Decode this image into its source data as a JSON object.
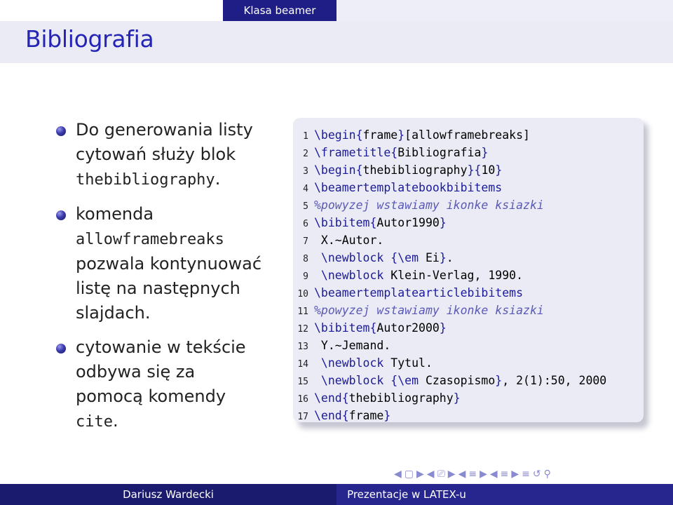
{
  "header": {
    "section": "Klasa beamer",
    "colors": {
      "section_bg": "#1e1e86",
      "title_text": "#2525b5"
    }
  },
  "frame": {
    "title": "Bibliografia"
  },
  "bullets": [
    {
      "pre": "Do generowania listy cytowań służy blok ",
      "code": "thebibliography",
      "post": "."
    },
    {
      "pre": "komenda ",
      "code": "allowframebreaks",
      "post": " pozwala kontynuować listę na następnych slajdach."
    },
    {
      "pre": "cytowanie w tekście odbywa się za pomocą komendy ",
      "code": "cite",
      "post": "."
    }
  ],
  "code": {
    "lines": [
      {
        "n": "1",
        "parts": [
          {
            "t": "\\begin{",
            "c": "kw"
          },
          {
            "t": "frame",
            "c": ""
          },
          {
            "t": "}",
            "c": "kw"
          },
          {
            "t": "[allowframebreaks]",
            "c": ""
          }
        ]
      },
      {
        "n": "2",
        "parts": [
          {
            "t": "\\frametitle{",
            "c": "kw"
          },
          {
            "t": "Bibliografia",
            "c": ""
          },
          {
            "t": "}",
            "c": "kw"
          }
        ]
      },
      {
        "n": "3",
        "parts": [
          {
            "t": "\\begin{",
            "c": "kw"
          },
          {
            "t": "thebibliography",
            "c": ""
          },
          {
            "t": "}{",
            "c": "kw"
          },
          {
            "t": "10",
            "c": ""
          },
          {
            "t": "}",
            "c": "kw"
          }
        ]
      },
      {
        "n": "4",
        "parts": [
          {
            "t": "\\beamertemplatebookbibitems",
            "c": "kw"
          }
        ]
      },
      {
        "n": "5",
        "parts": [
          {
            "t": "%powyzej wstawiamy ikonke ksiazki",
            "c": "cm"
          }
        ]
      },
      {
        "n": "6",
        "parts": [
          {
            "t": "\\bibitem{",
            "c": "kw"
          },
          {
            "t": "Autor1990",
            "c": ""
          },
          {
            "t": "}",
            "c": "kw"
          }
        ]
      },
      {
        "n": "7",
        "parts": [
          {
            "t": " X.~Autor.",
            "c": ""
          }
        ]
      },
      {
        "n": "8",
        "parts": [
          {
            "t": " \\newblock {\\em ",
            "c": "kw"
          },
          {
            "t": "Ei",
            "c": ""
          },
          {
            "t": "}",
            "c": "kw"
          },
          {
            "t": ".",
            "c": ""
          }
        ]
      },
      {
        "n": "9",
        "parts": [
          {
            "t": " \\newblock ",
            "c": "kw"
          },
          {
            "t": "Klein-Verlag, 1990.",
            "c": ""
          }
        ]
      },
      {
        "n": "10",
        "parts": [
          {
            "t": "\\beamertemplatearticlebibitems",
            "c": "kw"
          }
        ]
      },
      {
        "n": "11",
        "parts": [
          {
            "t": "%powyzej wstawiamy ikonke ksiazki",
            "c": "cm"
          }
        ]
      },
      {
        "n": "12",
        "parts": [
          {
            "t": "\\bibitem{",
            "c": "kw"
          },
          {
            "t": "Autor2000",
            "c": ""
          },
          {
            "t": "}",
            "c": "kw"
          }
        ]
      },
      {
        "n": "13",
        "parts": [
          {
            "t": " Y.~Jemand.",
            "c": ""
          }
        ]
      },
      {
        "n": "14",
        "parts": [
          {
            "t": " \\newblock ",
            "c": "kw"
          },
          {
            "t": "Tytul.",
            "c": ""
          }
        ]
      },
      {
        "n": "15",
        "parts": [
          {
            "t": " \\newblock {\\em ",
            "c": "kw"
          },
          {
            "t": "Czasopismo",
            "c": ""
          },
          {
            "t": "}",
            "c": "kw"
          },
          {
            "t": ", 2(1):50, 2000",
            "c": ""
          }
        ]
      },
      {
        "n": "16",
        "parts": [
          {
            "t": "\\end{",
            "c": "kw"
          },
          {
            "t": "thebibliography",
            "c": ""
          },
          {
            "t": "}",
            "c": "kw"
          }
        ]
      },
      {
        "n": "17",
        "parts": [
          {
            "t": "\\end{",
            "c": "kw"
          },
          {
            "t": "frame",
            "c": ""
          },
          {
            "t": "}",
            "c": "kw"
          }
        ]
      }
    ]
  },
  "navigation": {
    "symbols": [
      "◀",
      "▢",
      "▶",
      "◀",
      "⎚",
      "▶",
      "◀",
      "≡",
      "▶",
      "◀",
      "≡",
      "▶",
      "≡",
      "↺",
      "⚲"
    ]
  },
  "footer": {
    "author": "Dariusz Wardecki",
    "title": "Prezentacje w LATEX-u",
    "colors": {
      "left": "#1a1a6e",
      "right": "#26268e"
    }
  }
}
